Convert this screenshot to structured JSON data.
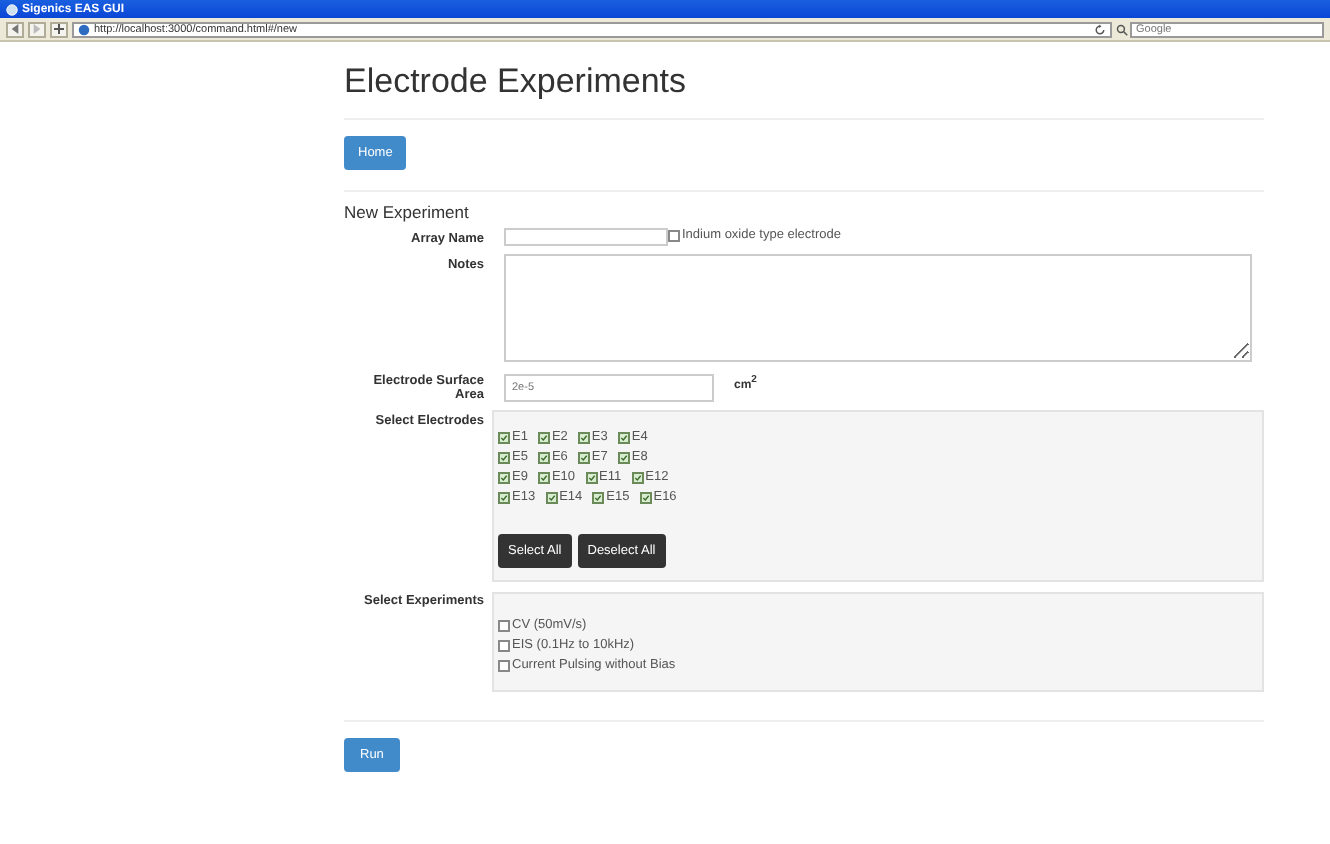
{
  "window": {
    "title": "Sigenics EAS GUI"
  },
  "browser": {
    "url": "http://localhost:3000/command.html#/new",
    "search_placeholder": "Google"
  },
  "heading": "Electrode Experiments",
  "home_button": "Home",
  "section_title": "New Experiment",
  "array_name": {
    "label": "Array Name",
    "checkbox": {
      "label": "Indium oxide type electrode",
      "checked": false
    }
  },
  "notes": {
    "label": "Notes"
  },
  "surface_area": {
    "label": "Electrode Surface Area",
    "placeholder": "2e-5",
    "unit": "cm$^{2}$"
  },
  "electrodes": {
    "label": "Select Electrodes",
    "rows": [
      [
        {
          "label": "E1",
          "checked": true
        },
        {
          "label": "E2",
          "checked": true
        },
        {
          "label": "E3",
          "checked": true
        },
        {
          "label": "E4",
          "checked": true
        }
      ],
      [
        {
          "label": "E5",
          "checked": true
        },
        {
          "label": "E6",
          "checked": true
        },
        {
          "label": "E7",
          "checked": true
        },
        {
          "label": "E8",
          "checked": true
        }
      ],
      [
        {
          "label": "E9",
          "checked": true
        },
        {
          "label": "E10",
          "checked": true
        },
        {
          "label": "E11",
          "checked": true
        },
        {
          "label": "E12",
          "checked": true
        }
      ],
      [
        {
          "label": "E13",
          "checked": true
        },
        {
          "label": "E14",
          "checked": true
        },
        {
          "label": "E15",
          "checked": true
        },
        {
          "label": "E16",
          "checked": true
        }
      ]
    ],
    "buttons": [
      "Select All",
      "Deselect All"
    ]
  },
  "experiments": {
    "label": "Select Experiments",
    "items": [
      {
        "label": "CV (50mV/s)",
        "checked": false
      },
      {
        "label": "EIS (0.1Hz to 10kHz)",
        "checked": false
      },
      {
        "label": "Current Pulsing without Bias",
        "checked": false
      }
    ]
  },
  "run_button": "Run"
}
